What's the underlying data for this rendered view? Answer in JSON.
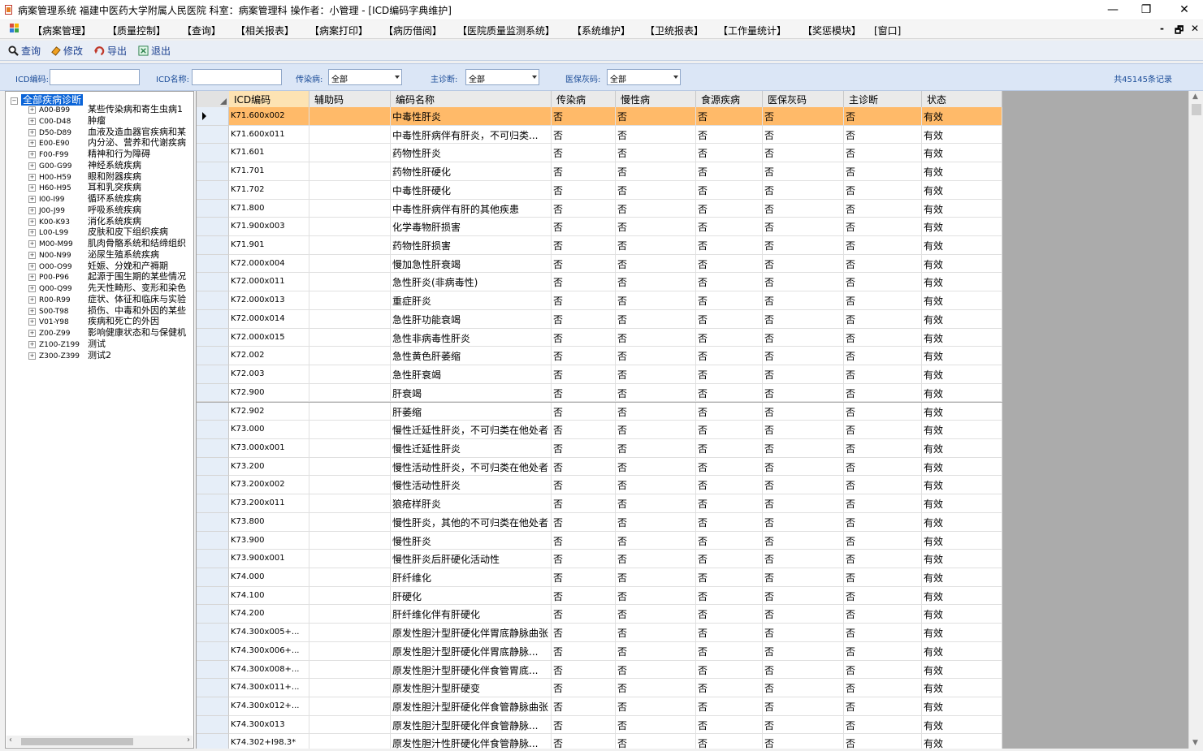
{
  "titlebar": {
    "title": "病案管理系统 福建中医药大学附属人民医院 科室：病案管理科 操作者：小管理 - [ICD编码字典维护]",
    "minimize": "—",
    "restore": "❐",
    "close": "✕"
  },
  "menubar": {
    "items": [
      "【病案管理】",
      "【质量控制】",
      "【查询】",
      "【相关报表】",
      "【病案打印】",
      "【病历借阅】",
      "【医院质量监测系统】",
      "【系统维护】",
      "【卫统报表】",
      "【工作量统计】",
      "【奖惩模块】",
      "[窗口]"
    ],
    "mdi_minimize": "-",
    "mdi_restore": "🗗",
    "mdi_close": "✕"
  },
  "toolbar": {
    "query": "查询",
    "edit": "修改",
    "export": "导出",
    "exit": "退出"
  },
  "filters": {
    "icd_code_label": "ICD编码:",
    "icd_code_value": "",
    "icd_name_label": "ICD名称:",
    "icd_name_value": "",
    "infectious_label": "传染病:",
    "infectious_value": "全部",
    "main_diag_label": "主诊断:",
    "main_diag_value": "全部",
    "insurance_gray_label": "医保灰码:",
    "insurance_gray_value": "全部",
    "record_count": "共45145条记录"
  },
  "tree": {
    "root": "全部疾病诊断",
    "nodes": [
      {
        "code": "A00-B99",
        "name": "某些传染病和寄生虫病1"
      },
      {
        "code": "C00-D48",
        "name": "肿瘤"
      },
      {
        "code": "D50-D89",
        "name": "血液及造血器官疾病和某"
      },
      {
        "code": "E00-E90",
        "name": "内分泌、营养和代谢疾病"
      },
      {
        "code": "F00-F99",
        "name": "精神和行为障碍"
      },
      {
        "code": "G00-G99",
        "name": "神经系统疾病"
      },
      {
        "code": "H00-H59",
        "name": "眼和附器疾病"
      },
      {
        "code": "H60-H95",
        "name": "耳和乳突疾病"
      },
      {
        "code": "I00-I99",
        "name": "循环系统疾病"
      },
      {
        "code": "J00-J99",
        "name": "呼吸系统疾病"
      },
      {
        "code": "K00-K93",
        "name": "消化系统疾病"
      },
      {
        "code": "L00-L99",
        "name": "皮肤和皮下组织疾病"
      },
      {
        "code": "M00-M99",
        "name": "肌肉骨骼系统和结缔组织"
      },
      {
        "code": "N00-N99",
        "name": "泌尿生殖系统疾病"
      },
      {
        "code": "O00-O99",
        "name": "妊娠、分娩和产褥期"
      },
      {
        "code": "P00-P96",
        "name": "起源于围生期的某些情况"
      },
      {
        "code": "Q00-Q99",
        "name": "先天性畸形、变形和染色"
      },
      {
        "code": "R00-R99",
        "name": "症状、体征和临床与实验"
      },
      {
        "code": "S00-T98",
        "name": "损伤、中毒和外因的某些"
      },
      {
        "code": "V01-Y98",
        "name": "疾病和死亡的外因"
      },
      {
        "code": "Z00-Z99",
        "name": "影响健康状态和与保健机"
      },
      {
        "code": "Z100-Z199",
        "name": "测试"
      },
      {
        "code": "Z300-Z399",
        "name": "测试2"
      }
    ]
  },
  "grid": {
    "columns": [
      "ICD编码",
      "辅助码",
      "编码名称",
      "传染病",
      "慢性病",
      "食源疾病",
      "医保灰码",
      "主诊断",
      "状态"
    ],
    "rows": [
      [
        "K71.600x002",
        "",
        "中毒性肝炎",
        "否",
        "否",
        "否",
        "否",
        "否",
        "有效"
      ],
      [
        "K71.600x011",
        "",
        "中毒性肝病伴有肝炎，不可归类...",
        "否",
        "否",
        "否",
        "否",
        "否",
        "有效"
      ],
      [
        "K71.601",
        "",
        "药物性肝炎",
        "否",
        "否",
        "否",
        "否",
        "否",
        "有效"
      ],
      [
        "K71.701",
        "",
        "药物性肝硬化",
        "否",
        "否",
        "否",
        "否",
        "否",
        "有效"
      ],
      [
        "K71.702",
        "",
        "中毒性肝硬化",
        "否",
        "否",
        "否",
        "否",
        "否",
        "有效"
      ],
      [
        "K71.800",
        "",
        "中毒性肝病伴有肝的其他疾患",
        "否",
        "否",
        "否",
        "否",
        "否",
        "有效"
      ],
      [
        "K71.900x003",
        "",
        "化学毒物肝损害",
        "否",
        "否",
        "否",
        "否",
        "否",
        "有效"
      ],
      [
        "K71.901",
        "",
        "药物性肝损害",
        "否",
        "否",
        "否",
        "否",
        "否",
        "有效"
      ],
      [
        "K72.000x004",
        "",
        "慢加急性肝衰竭",
        "否",
        "否",
        "否",
        "否",
        "否",
        "有效"
      ],
      [
        "K72.000x011",
        "",
        "急性肝炎(非病毒性)",
        "否",
        "否",
        "否",
        "否",
        "否",
        "有效"
      ],
      [
        "K72.000x013",
        "",
        "重症肝炎",
        "否",
        "否",
        "否",
        "否",
        "否",
        "有效"
      ],
      [
        "K72.000x014",
        "",
        "急性肝功能衰竭",
        "否",
        "否",
        "否",
        "否",
        "否",
        "有效"
      ],
      [
        "K72.000x015",
        "",
        "急性非病毒性肝炎",
        "否",
        "否",
        "否",
        "否",
        "否",
        "有效"
      ],
      [
        "K72.002",
        "",
        "急性黄色肝萎缩",
        "否",
        "否",
        "否",
        "否",
        "否",
        "有效"
      ],
      [
        "K72.003",
        "",
        "急性肝衰竭",
        "否",
        "否",
        "否",
        "否",
        "否",
        "有效"
      ],
      [
        "K72.900",
        "",
        "肝衰竭",
        "否",
        "否",
        "否",
        "否",
        "否",
        "有效"
      ],
      [
        "K72.902",
        "",
        "肝萎缩",
        "否",
        "否",
        "否",
        "否",
        "否",
        "有效"
      ],
      [
        "K73.000",
        "",
        "慢性迁延性肝炎，不可归类在他处者",
        "否",
        "否",
        "否",
        "否",
        "否",
        "有效"
      ],
      [
        "K73.000x001",
        "",
        "慢性迁延性肝炎",
        "否",
        "否",
        "否",
        "否",
        "否",
        "有效"
      ],
      [
        "K73.200",
        "",
        "慢性活动性肝炎，不可归类在他处者",
        "否",
        "否",
        "否",
        "否",
        "否",
        "有效"
      ],
      [
        "K73.200x002",
        "",
        "慢性活动性肝炎",
        "否",
        "否",
        "否",
        "否",
        "否",
        "有效"
      ],
      [
        "K73.200x011",
        "",
        "狼疮样肝炎",
        "否",
        "否",
        "否",
        "否",
        "否",
        "有效"
      ],
      [
        "K73.800",
        "",
        "慢性肝炎，其他的不可归类在他处者",
        "否",
        "否",
        "否",
        "否",
        "否",
        "有效"
      ],
      [
        "K73.900",
        "",
        "慢性肝炎",
        "否",
        "否",
        "否",
        "否",
        "否",
        "有效"
      ],
      [
        "K73.900x001",
        "",
        "慢性肝炎后肝硬化活动性",
        "否",
        "否",
        "否",
        "否",
        "否",
        "有效"
      ],
      [
        "K74.000",
        "",
        "肝纤维化",
        "否",
        "否",
        "否",
        "否",
        "否",
        "有效"
      ],
      [
        "K74.100",
        "",
        "肝硬化",
        "否",
        "否",
        "否",
        "否",
        "否",
        "有效"
      ],
      [
        "K74.200",
        "",
        "肝纤维化伴有肝硬化",
        "否",
        "否",
        "否",
        "否",
        "否",
        "有效"
      ],
      [
        "K74.300x005+...",
        "",
        "原发性胆汁型肝硬化伴胃底静脉曲张",
        "否",
        "否",
        "否",
        "否",
        "否",
        "有效"
      ],
      [
        "K74.300x006+...",
        "",
        "原发性胆汁型肝硬化伴胃底静脉...",
        "否",
        "否",
        "否",
        "否",
        "否",
        "有效"
      ],
      [
        "K74.300x008+...",
        "",
        "原发性胆汁型肝硬化伴食管胃底...",
        "否",
        "否",
        "否",
        "否",
        "否",
        "有效"
      ],
      [
        "K74.300x011+...",
        "",
        "原发性胆汁型肝硬变",
        "否",
        "否",
        "否",
        "否",
        "否",
        "有效"
      ],
      [
        "K74.300x012+...",
        "",
        "原发性胆汁型肝硬化伴食管静脉曲张",
        "否",
        "否",
        "否",
        "否",
        "否",
        "有效"
      ],
      [
        "K74.300x013",
        "",
        "原发性胆汁型肝硬化伴食管静脉...",
        "否",
        "否",
        "否",
        "否",
        "否",
        "有效"
      ],
      [
        "K74.302+I98.3*",
        "",
        "原发性胆汁性肝硬化伴食管静脉...",
        "否",
        "否",
        "否",
        "否",
        "否",
        "有效"
      ]
    ]
  },
  "colors": {
    "active_row": "#ffba69",
    "tree_selected": "#0a64d8",
    "toolbar_text": "#1a3f8f"
  }
}
